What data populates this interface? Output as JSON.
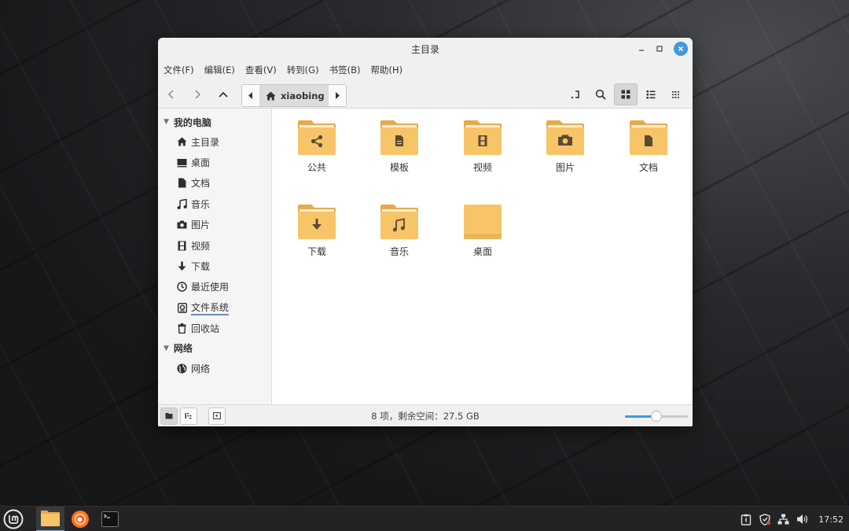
{
  "window": {
    "title": "主目录"
  },
  "menubar": {
    "items": [
      "文件(F)",
      "编辑(E)",
      "查看(V)",
      "转到(G)",
      "书签(B)",
      "帮助(H)"
    ]
  },
  "pathbar": {
    "crumb": "xiaobing"
  },
  "sidebar": {
    "sections": [
      {
        "label": "我的电脑"
      },
      {
        "label": "网络"
      }
    ],
    "computer_items": [
      "主目录",
      "桌面",
      "文档",
      "音乐",
      "图片",
      "视频",
      "下载",
      "最近使用",
      "文件系统",
      "回收站"
    ],
    "network_items": [
      "网络"
    ]
  },
  "files": [
    "公共",
    "模板",
    "视频",
    "图片",
    "文档",
    "下载",
    "音乐",
    "桌面"
  ],
  "statusbar": {
    "text": "8 项，剩余空间：27.5 GB",
    "zoom_fraction": 0.5
  },
  "taskbar": {
    "clock": "17:52"
  },
  "colors": {
    "folder": "#f7c468",
    "folder_dark": "#e7a94a",
    "folder_glyph": "#5a4a35",
    "accent": "#3f97df"
  }
}
